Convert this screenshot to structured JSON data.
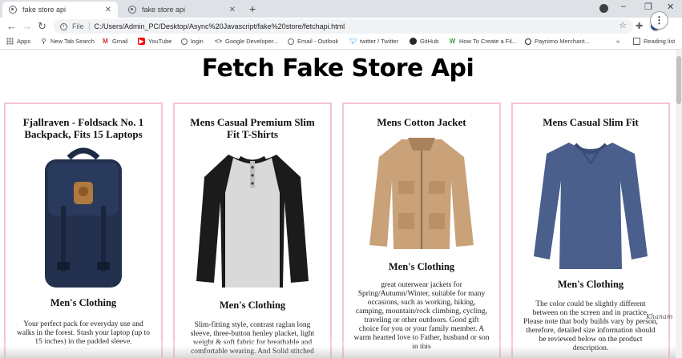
{
  "tabs": [
    {
      "title": "fake store api",
      "active": true
    },
    {
      "title": "fake store api",
      "active": false
    }
  ],
  "window_controls": {
    "minimize": "–",
    "maximize": "❐",
    "close": "✕",
    "newtab": "+"
  },
  "toolbar": {
    "back": "←",
    "forward": "→",
    "reload": "↻",
    "file_label": "File",
    "url": "C:/Users/Admin_PC/Desktop/Async%20Javascript/fake%20store/fetchapi.html",
    "star": "☆",
    "menu": "⋮"
  },
  "bookmarks": [
    {
      "label": "Apps",
      "icon": "apps-grid-icon"
    },
    {
      "label": "New Tab Search",
      "icon": "search-icon"
    },
    {
      "label": "Gmail",
      "icon": "gmail-icon"
    },
    {
      "label": "YouTube",
      "icon": "youtube-icon"
    },
    {
      "label": "login",
      "icon": "globe-icon"
    },
    {
      "label": "Google Developer...",
      "icon": "code-icon"
    },
    {
      "label": "Email - Outlook",
      "icon": "globe-icon"
    },
    {
      "label": "twitter / Twitter",
      "icon": "twitter-icon"
    },
    {
      "label": "GitHub",
      "icon": "github-icon"
    },
    {
      "label": "How To Create a Fil...",
      "icon": "w-icon"
    },
    {
      "label": "Paynimo Merchant...",
      "icon": "circle-icon"
    }
  ],
  "bookmarks_more": "»",
  "reading_list": "Reading list",
  "page": {
    "title": "Fetch Fake Store Api"
  },
  "products": [
    {
      "title": "Fjallraven - Foldsack No. 1 Backpack, Fits 15 Laptops",
      "category": "Men's Clothing",
      "description": "Your perfect pack for everyday use and walks in the forest. Stash your laptop (up to 15 inches) in the padded sleeve,"
    },
    {
      "title": "Mens Casual Premium Slim Fit T-Shirts",
      "category": "Men's Clothing",
      "description": "Slim-fitting style, contrast raglan long sleeve, three-button henley placket, light weight & soft fabric for breathable and comfortable wearing. And Solid stitched"
    },
    {
      "title": "Mens Cotton Jacket",
      "category": "Men's Clothing",
      "description": "great outerwear jackets for Spring/Autumn/Winter, suitable for many occasions, such as working, hiking, camping, mountain/rock climbing, cycling, traveling or other outdoors. Good gift choice for you or your family member. A warm hearted love to Father, husband or son in this"
    },
    {
      "title": "Mens Casual Slim Fit",
      "category": "Men's Clothing",
      "description": "The color could be slightly different between on the screen and in practice. Please note that body builds vary by person, therefore, detailed size information should be reviewed below on the product description."
    }
  ],
  "watermark": "Khanam"
}
